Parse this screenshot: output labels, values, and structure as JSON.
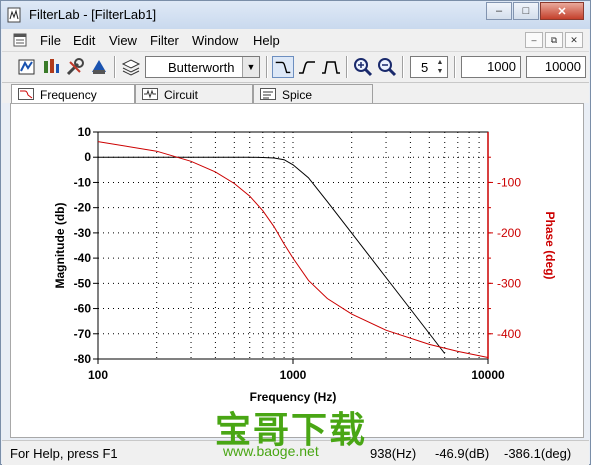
{
  "window": {
    "title": "FilterLab - [FilterLab1]",
    "minimize_glyph": "–",
    "maximize_glyph": "□",
    "close_glyph": "✕"
  },
  "menu": {
    "items": [
      {
        "label": "File"
      },
      {
        "label": "Edit"
      },
      {
        "label": "View"
      },
      {
        "label": "Filter"
      },
      {
        "label": "Window"
      },
      {
        "label": "Help"
      }
    ],
    "mdi_min": "–",
    "mdi_restore": "⧉",
    "mdi_close": "✕"
  },
  "toolbar": {
    "filter_type": "Butterworth",
    "order": "5",
    "freq_low": "1000",
    "freq_high": "10000"
  },
  "tabs": [
    {
      "label": "Frequency",
      "icon": "frequency-plot-icon"
    },
    {
      "label": "Circuit",
      "icon": "circuit-icon"
    },
    {
      "label": "Spice",
      "icon": "spice-icon"
    }
  ],
  "chart_data": {
    "type": "line",
    "xlabel": "Frequency (Hz)",
    "ylabel_left": "Magnitude (db)",
    "ylabel_right": "Phase (deg)",
    "x_scale": "log",
    "xlim": [
      100,
      10000
    ],
    "x_ticks": [
      "100",
      "1000",
      "10000"
    ],
    "ylim_left": [
      -80,
      10
    ],
    "y_ticks_left": [
      "10",
      "0",
      "-10",
      "-20",
      "-30",
      "-40",
      "-50",
      "-60",
      "-70",
      "-80"
    ],
    "ylim_right": [
      -450,
      0
    ],
    "y_ticks_right": [
      "-100",
      "-200",
      "-300",
      "-400"
    ],
    "grid": true,
    "series": [
      {
        "axis": "left",
        "color": "#000000",
        "x": [
          100,
          200,
          400,
          600,
          700,
          800,
          900,
          1000,
          1200,
          1500,
          2000,
          3000,
          5000,
          6000
        ],
        "y": [
          0,
          0,
          0,
          0,
          -0.1,
          -0.3,
          -1,
          -3,
          -8.1,
          -17.6,
          -30.1,
          -47.7,
          -69.9,
          -77.8
        ]
      },
      {
        "axis": "right",
        "color": "#cc0000",
        "x": [
          100,
          200,
          300,
          400,
          500,
          600,
          700,
          800,
          900,
          1000,
          1200,
          1500,
          2000,
          3000,
          5000,
          7000,
          10000
        ],
        "y": [
          -19,
          -38,
          -58,
          -79,
          -102,
          -127,
          -156,
          -188,
          -222,
          -250,
          -294,
          -330,
          -361,
          -393,
          -421,
          -435,
          -447
        ]
      }
    ]
  },
  "status": {
    "help": "For Help, press F1",
    "frequency": "938(Hz)",
    "magnitude": "-46.9(dB)",
    "phase": "-386.1(deg)"
  },
  "watermark": {
    "cn": "宝哥下载",
    "url": "www.baoge.net"
  },
  "colors": {
    "magnitude": "#000000",
    "phase": "#cc0000",
    "watermark": "#49a614"
  }
}
